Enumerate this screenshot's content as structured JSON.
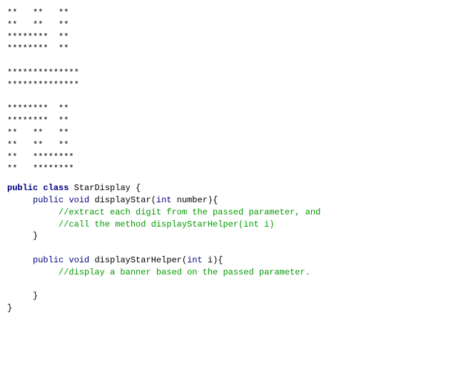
{
  "ascii_art": "**   **   **\n**   **   **\n********  **\n********  **\n\n**************\n**************\n\n********  **\n********  **\n**   **   **\n**   **   **\n**   ********\n**   ********",
  "code": {
    "kw_public": "public",
    "kw_class": "class",
    "kw_void": "void",
    "kw_int": "int",
    "class_name": " StarDisplay {",
    "method1_sig_a": " displayStar(",
    "method1_sig_b": " number){",
    "method1_comment1": "//extract each digit from the passed parameter, and",
    "method1_comment2": "//call the method displayStarHelper(int i)",
    "method2_sig_a": " displayStarHelper(",
    "method2_sig_b": " i){",
    "method2_comment1": "//display a banner based on the passed parameter.",
    "brace_close": "}"
  }
}
